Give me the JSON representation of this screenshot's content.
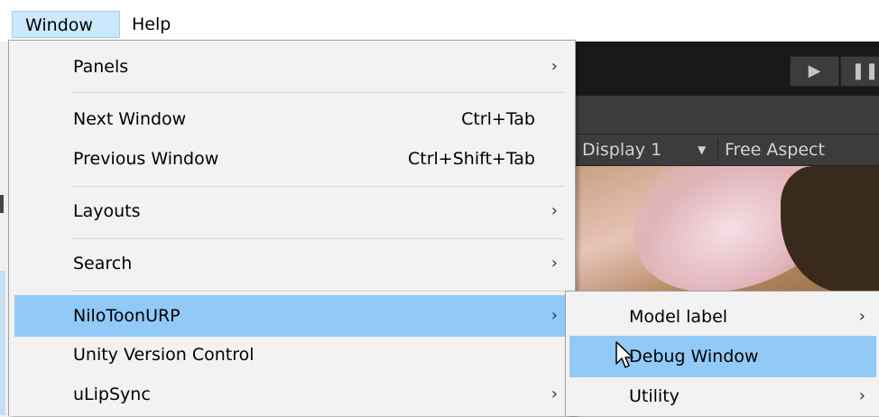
{
  "menubar": {
    "items": [
      {
        "label": "Window"
      },
      {
        "label": "Help"
      }
    ]
  },
  "editor": {
    "play_icon": "play-icon",
    "pause_icon": "pause-icon",
    "display": "Display 1",
    "aspect": "Free Aspect"
  },
  "window_menu": {
    "panels": "Panels",
    "next_window": "Next Window",
    "next_window_shortcut": "Ctrl+Tab",
    "previous_window": "Previous Window",
    "previous_window_shortcut": "Ctrl+Shift+Tab",
    "layouts": "Layouts",
    "search": "Search",
    "nilotoonurp": "NiloToonURP",
    "unity_version_control": "Unity Version Control",
    "ulipsync": "uLipSync"
  },
  "submenu": {
    "model_label": "Model label",
    "debug_window": "Debug Window",
    "utility": "Utility"
  },
  "colors": {
    "highlight": "#91c9f7",
    "menu_bg": "#f2f2f2",
    "menubar_open": "#cce8ff"
  }
}
